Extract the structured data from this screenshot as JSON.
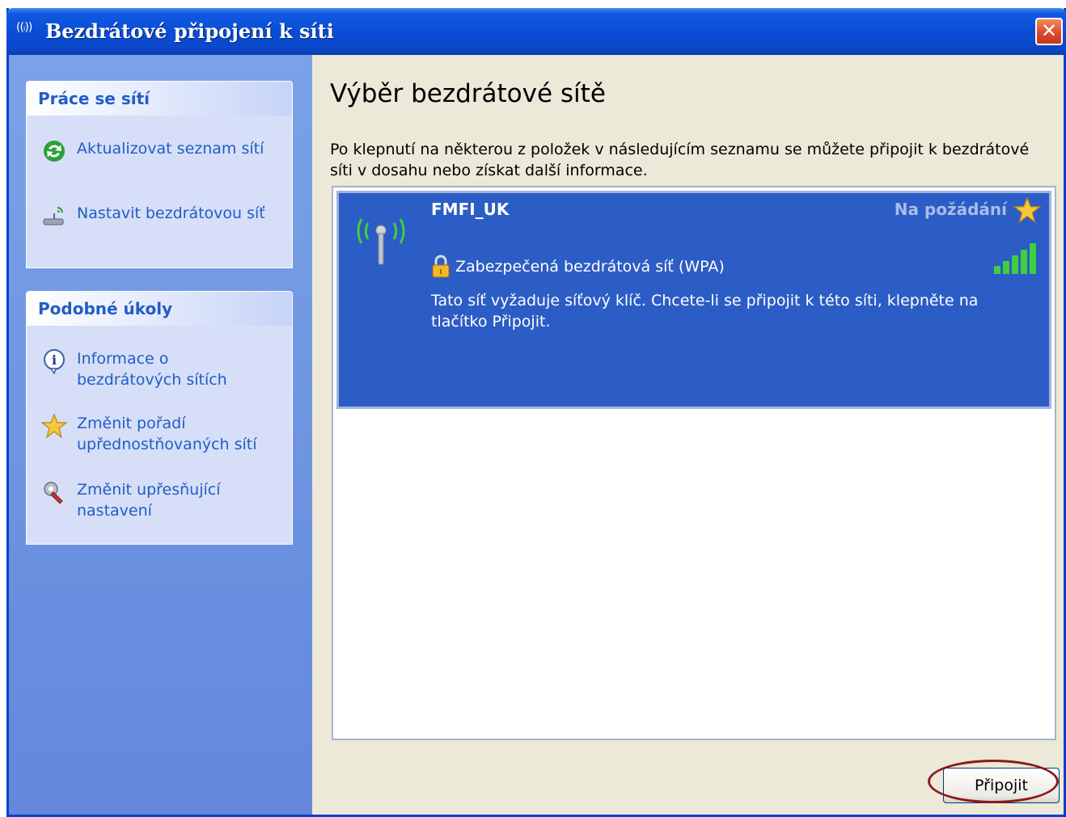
{
  "window": {
    "title": "Bezdrátové připojení k síti",
    "title_icon": "((ᵢ))",
    "close_label": "✕"
  },
  "sidebar": {
    "network_tasks": {
      "header": "Práce se sítí",
      "items": [
        {
          "label": "Aktualizovat seznam sítí",
          "icon": "refresh-icon"
        },
        {
          "label": "Nastavit bezdrátovou síť",
          "icon": "wireless-setup-icon"
        }
      ]
    },
    "related_tasks": {
      "header": "Podobné úkoly",
      "items": [
        {
          "label_line1": "Informace o",
          "label_line2": "bezdrátových sítích",
          "icon": "info-icon"
        },
        {
          "label_line1": "Změnit pořadí",
          "label_line2": "upřednostňovaných sítí",
          "icon": "star-icon"
        },
        {
          "label_line1": "Změnit upřesňující",
          "label_line2": "nastavení",
          "icon": "settings-icon"
        }
      ]
    }
  },
  "main": {
    "heading": "Výběr bezdrátové sítě",
    "description": "Po klepnutí na některou z položek v následujícím seznamu se můžete připojit k bezdrátové síti v dosahu nebo získat další informace.",
    "networks": [
      {
        "name": "FMFI_UK",
        "preference": "Na požádání",
        "security": "Zabezpečená bezdrátová síť (WPA)",
        "info": "Tato síť vyžaduje síťový klíč. Chcete-li se připojit k této síti, klepněte na tlačítko Připojit.",
        "signal_bars": 5
      }
    ],
    "connect_label": "Připojit"
  },
  "colors": {
    "titlebar": "#0a4ed6",
    "sidebar": "#6b8fe0",
    "task_link": "#215dc6",
    "selected_item": "#2c5cc5",
    "highlight_ellipse": "#8a1b1b"
  }
}
